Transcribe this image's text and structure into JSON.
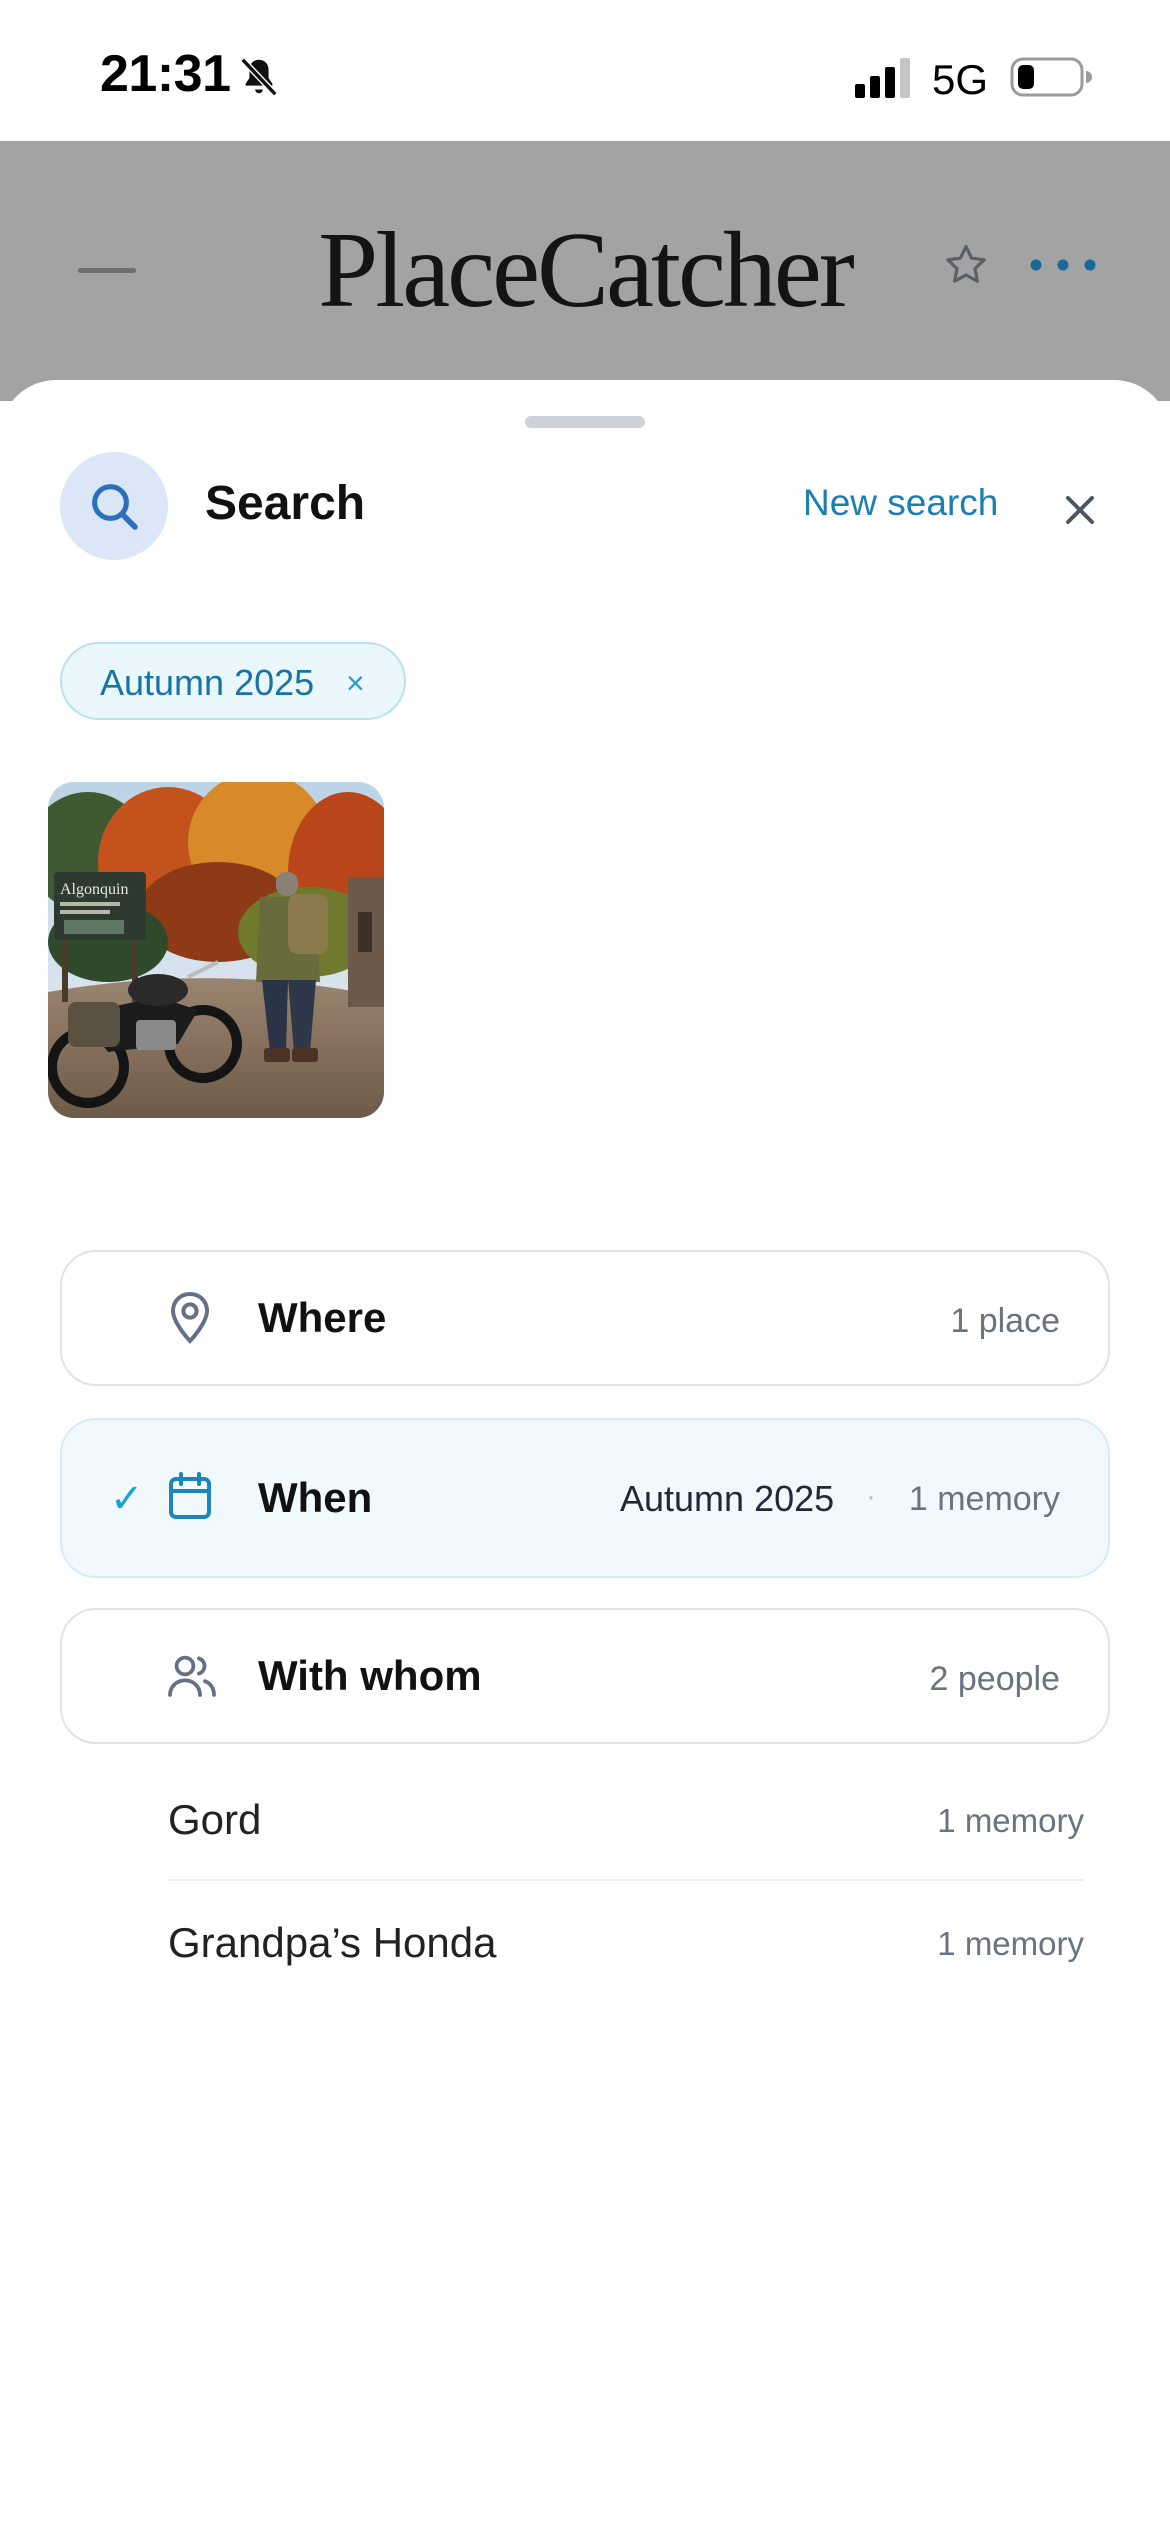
{
  "status_bar": {
    "time": "21:31",
    "network": "5G",
    "icons": [
      "bell-slash-icon",
      "signal-icon",
      "battery-icon"
    ]
  },
  "app_header": {
    "title": "PlaceCatcher",
    "icons": [
      "dash-icon",
      "star-icon",
      "more-icon"
    ]
  },
  "sheet": {
    "title": "Search",
    "new_search_label": "New search",
    "close_icon": "close-icon",
    "search_icon": "search-icon"
  },
  "active_filters": [
    {
      "label": "Autumn 2025",
      "remove_symbol": "×"
    }
  ],
  "results": {
    "photo_count": 1,
    "photo_sign_text": "Algonquin"
  },
  "filters": {
    "where": {
      "label": "Where",
      "meta": "1 place",
      "icon": "location-pin-icon"
    },
    "when": {
      "label": "When",
      "value": "Autumn 2025",
      "separator": "·",
      "meta": "1 memory",
      "check": "✓",
      "icon": "calendar-icon"
    },
    "with_whom": {
      "label": "With whom",
      "meta": "2 people",
      "icon": "people-icon"
    }
  },
  "people": [
    {
      "name": "Gord",
      "meta": "1 memory"
    },
    {
      "name": "Grandpa’s Honda",
      "meta": "1 memory"
    }
  ],
  "colors": {
    "accent": "#1b7fb0",
    "chip_bg": "#eaf7fd",
    "active_row_bg": "#f2f9fd",
    "check": "#1aa3d4"
  }
}
